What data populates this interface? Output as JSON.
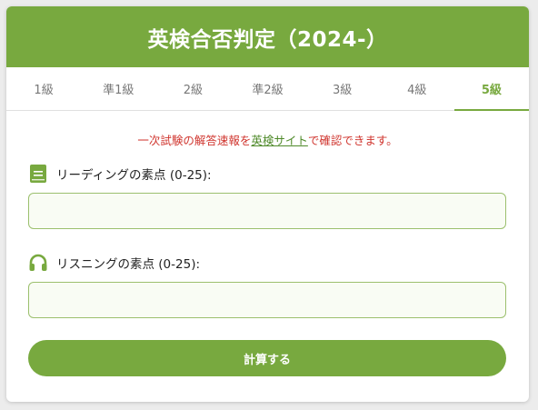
{
  "header": {
    "title": "英検合否判定（2024-）"
  },
  "tabs": [
    {
      "label": "1級"
    },
    {
      "label": "準1級"
    },
    {
      "label": "2級"
    },
    {
      "label": "準2級"
    },
    {
      "label": "3級"
    },
    {
      "label": "4級"
    },
    {
      "label": "5級"
    }
  ],
  "active_tab": "5級",
  "notice": {
    "before": "一次試験の解答速報を",
    "link": "英検サイト",
    "after": "で確認できます。"
  },
  "reading": {
    "label": "リーディングの素点 (0-25):",
    "icon": "book-icon",
    "value": ""
  },
  "listening": {
    "label": "リスニングの素点 (0-25):",
    "icon": "headphones-icon",
    "value": ""
  },
  "calculate_button": {
    "label": "計算する"
  },
  "colors": {
    "accent": "#78a93f",
    "notice_text": "#d0362f",
    "link": "#4f8a2a"
  }
}
